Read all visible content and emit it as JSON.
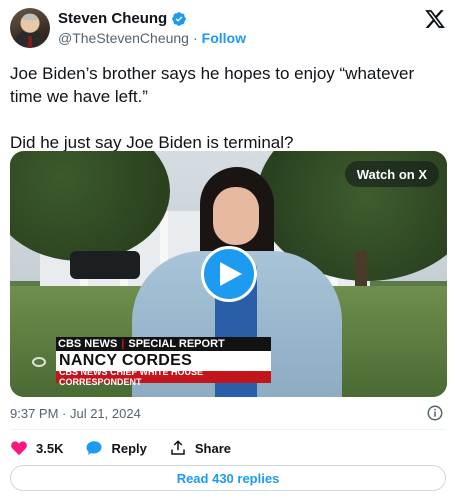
{
  "author": {
    "name": "Steven Cheung",
    "handle": "@TheStevenCheung",
    "separator": "·",
    "follow_label": "Follow"
  },
  "tweet": {
    "text": "Joe Biden’s brother says he hopes to enjoy “whatever time we have left.”\n\nDid he just say Joe Biden is terminal?"
  },
  "media": {
    "watch_label": "Watch on X",
    "lower_third": {
      "network": "CBS NEWS",
      "segment": "SPECIAL REPORT",
      "name": "NANCY CORDES",
      "title": "CBS NEWS CHIEF WHITE HOUSE CORRESPONDENT"
    }
  },
  "meta": {
    "timestamp": "9:37 PM · Jul 21, 2024"
  },
  "actions": {
    "likes": "3.5K",
    "reply_label": "Reply",
    "share_label": "Share"
  },
  "replies_button": "Read 430 replies",
  "colors": {
    "accent": "#1d9bf0",
    "like": "#f91880",
    "text": "#0f1419",
    "muted": "#536471",
    "cbs_red": "#c3161c"
  },
  "icons": [
    "verified-badge-icon",
    "x-logo-icon",
    "play-icon",
    "info-icon",
    "heart-icon",
    "reply-bubble-icon",
    "share-icon"
  ]
}
